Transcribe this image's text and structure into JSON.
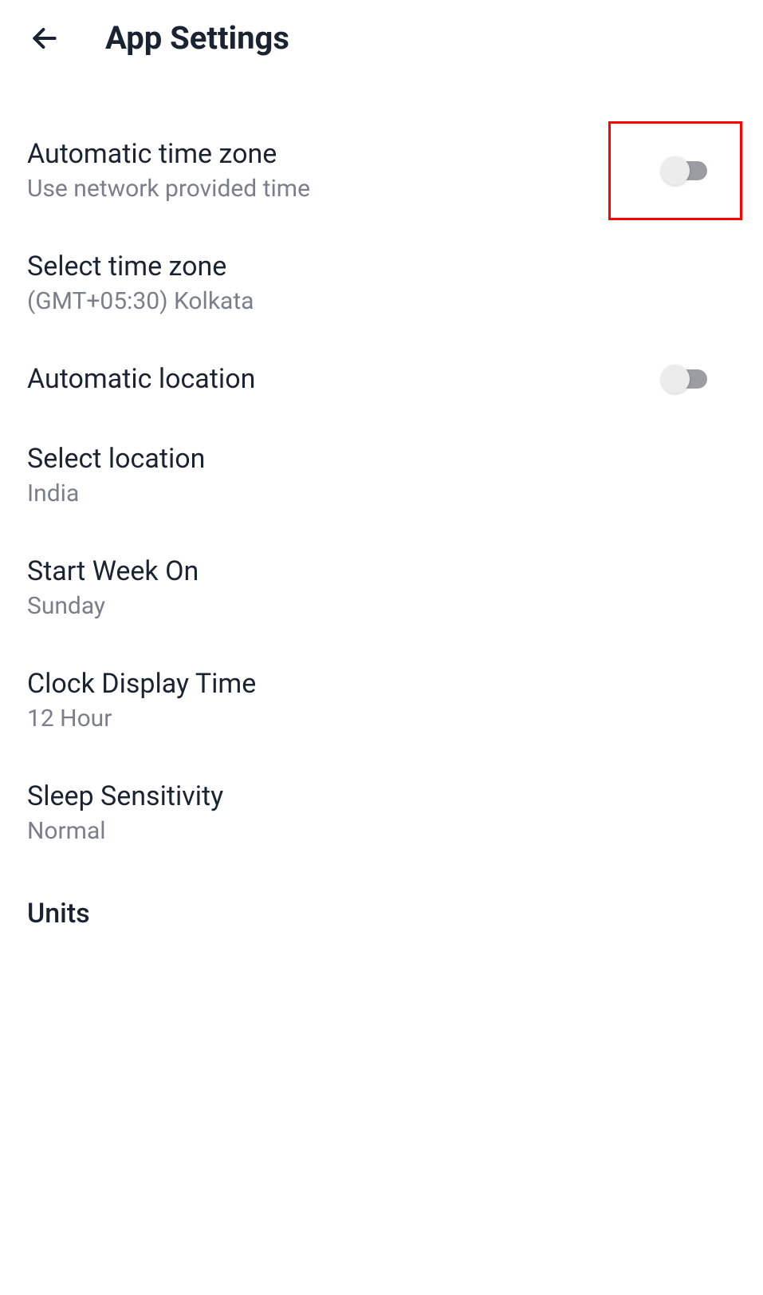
{
  "header": {
    "title": "App Settings"
  },
  "settings": {
    "automatic_time_zone": {
      "title": "Automatic time zone",
      "subtitle": "Use network provided time",
      "toggled": false,
      "highlighted": true
    },
    "select_time_zone": {
      "title": "Select time zone",
      "subtitle": "(GMT+05:30) Kolkata"
    },
    "automatic_location": {
      "title": "Automatic location",
      "toggled": false
    },
    "select_location": {
      "title": "Select location",
      "subtitle": "India"
    },
    "start_week_on": {
      "title": "Start Week On",
      "subtitle": "Sunday"
    },
    "clock_display_time": {
      "title": "Clock Display Time",
      "subtitle": "12 Hour"
    },
    "sleep_sensitivity": {
      "title": "Sleep Sensitivity",
      "subtitle": "Normal"
    },
    "units": {
      "title": "Units"
    }
  }
}
